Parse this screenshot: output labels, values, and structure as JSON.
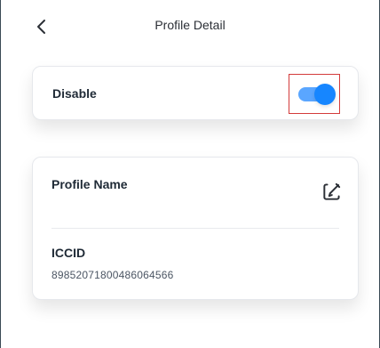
{
  "header": {
    "title": "Profile Detail",
    "back_icon": "chevron-left-icon"
  },
  "main": {
    "toggle_card": {
      "label": "Disable",
      "switch_state": "on",
      "highlight_color": "#d33b3b",
      "switch_color": "#1686ff"
    },
    "profile_card": {
      "profile_name_label": "Profile Name",
      "edit_icon": "edit-icon",
      "iccid_label": "ICCID",
      "iccid_value": "89852071800486064566"
    }
  }
}
